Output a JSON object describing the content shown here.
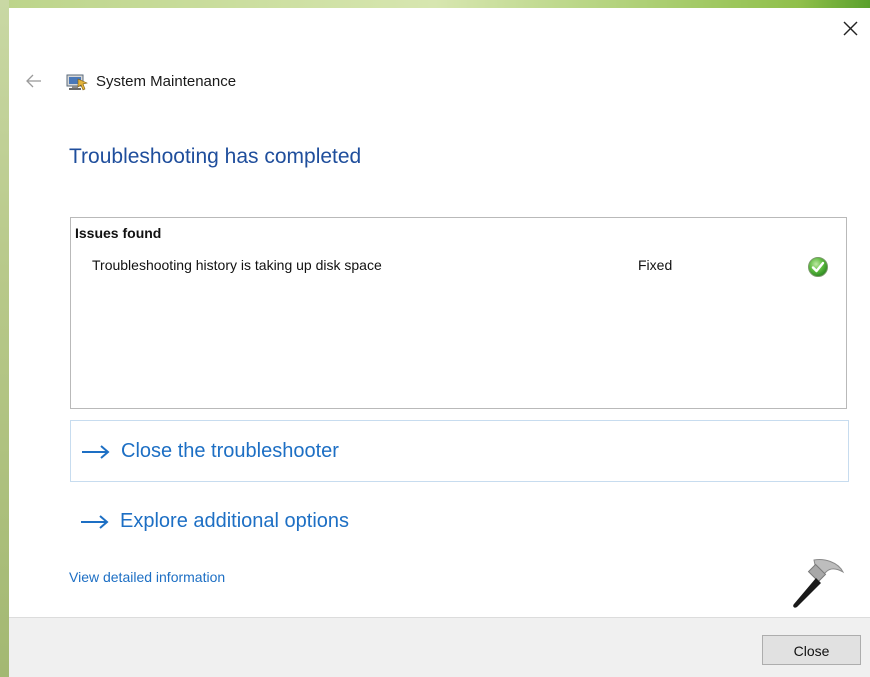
{
  "window": {
    "title": "System Maintenance",
    "app_icon": "system-maintenance-icon",
    "back_icon": "back-arrow-icon",
    "close_icon": "close-icon"
  },
  "page": {
    "heading": "Troubleshooting has completed"
  },
  "issues": {
    "header": "Issues found",
    "rows": [
      {
        "name": "Troubleshooting history is taking up disk space",
        "status": "Fixed",
        "status_icon": "green-checkmark-icon"
      }
    ]
  },
  "actions": {
    "close_troubleshooter": "Close the troubleshooter",
    "explore_options": "Explore additional options",
    "arrow_icon": "right-arrow-icon",
    "view_details": "View detailed information"
  },
  "footer": {
    "close_button": "Close"
  },
  "colors": {
    "heading_blue": "#1f4e9c",
    "link_blue": "#1d6fc4",
    "status_green": "#3fa83a",
    "footer_bg": "#f0f0f0"
  }
}
